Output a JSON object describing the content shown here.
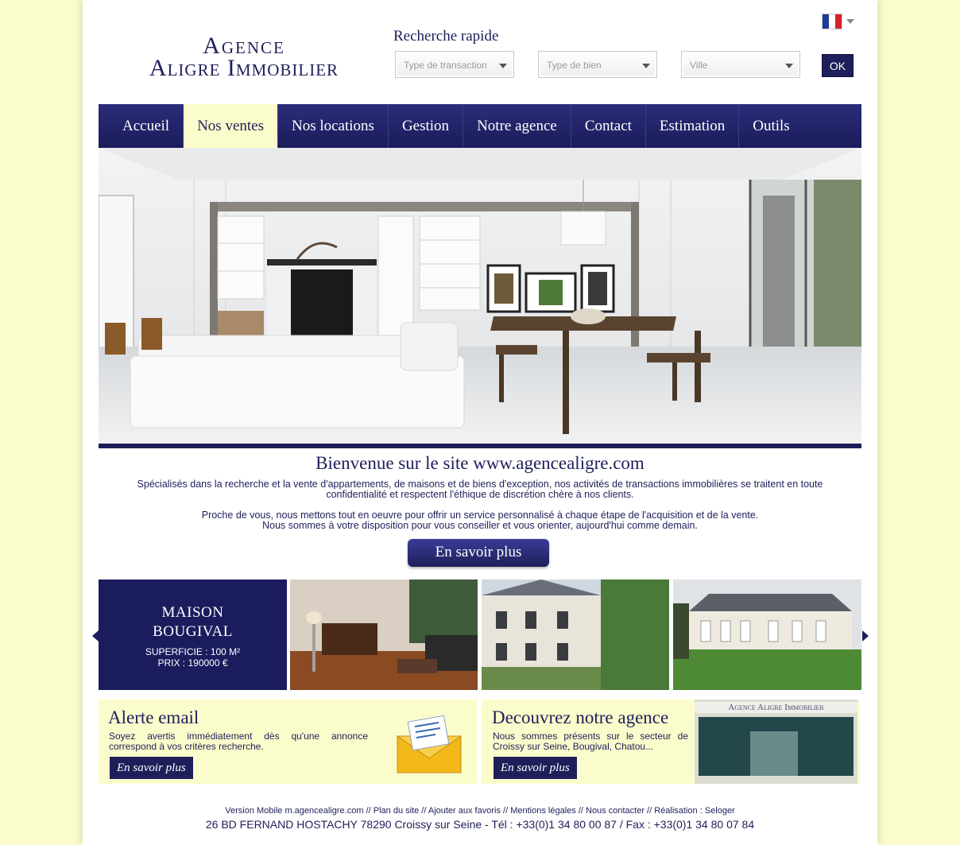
{
  "logo": {
    "line1": "Agence",
    "line2": "Aligre Immobilier"
  },
  "search": {
    "title": "Recherche rapide",
    "transaction_placeholder": "Type de transaction",
    "bien_placeholder": "Type de bien",
    "ville_placeholder": "Ville",
    "ok_label": "OK"
  },
  "language": {
    "icon": "french-flag-icon"
  },
  "nav": {
    "items": [
      {
        "label": "Accueil"
      },
      {
        "label": "Nos ventes"
      },
      {
        "label": "Nos locations"
      },
      {
        "label": "Gestion"
      },
      {
        "label": "Notre agence"
      },
      {
        "label": "Contact"
      },
      {
        "label": "Estimation"
      },
      {
        "label": "Outils"
      }
    ],
    "active": "Nos ventes"
  },
  "welcome": {
    "title": "Bienvenue sur le site www.agencealigre.com",
    "p1": "Spécialisés dans la recherche et la vente d'appartements, de maisons et de biens d'exception, nos activités de transactions immobilières se traitent en toute confidentialité et respectent l'éthique de discrétion chère à nos clients.",
    "p2a": "Proche de vous, nous mettons tout en oeuvre pour offrir un service personnalisé à chaque étape de l'acquisition et de la vente.",
    "p2b": "Nous sommes à votre disposition pour vous conseiller et vous orienter, aujourd'hui comme demain.",
    "button": "En savoir plus"
  },
  "carousel": {
    "featured": {
      "name_line1": "MAISON",
      "name_line2": "BOUGIVAL",
      "surface": "SUPERFICIE : 100 M²",
      "price": "PRIX : 190000 €"
    }
  },
  "alert": {
    "title": "Alerte email",
    "text": "Soyez avertis immédiatement dès qu'une annonce correspond à vos critères recherche.",
    "button": "En savoir plus"
  },
  "agency": {
    "title": "Decouvrez notre agence",
    "text": "Nous sommes présents sur le secteur de Croissy sur Seine, Bougival, Chatou...",
    "button": "En savoir plus",
    "sign": "Agence Aligre Immobilier"
  },
  "footer": {
    "links": [
      "Version Mobile m.agencealigre.com",
      "Plan du site",
      "Ajouter aux favoris",
      "Mentions légales",
      "Nous contacter",
      "Réalisation : Seloger"
    ],
    "address": "26 BD FERNAND HOSTACHY 78290 Croissy sur Seine - Tél : +33(0)1 34 80 00 87 / Fax : +33(0)1 34 80 07 84"
  },
  "colors": {
    "navy": "#1e1f5a",
    "cream": "#fbfccb"
  }
}
